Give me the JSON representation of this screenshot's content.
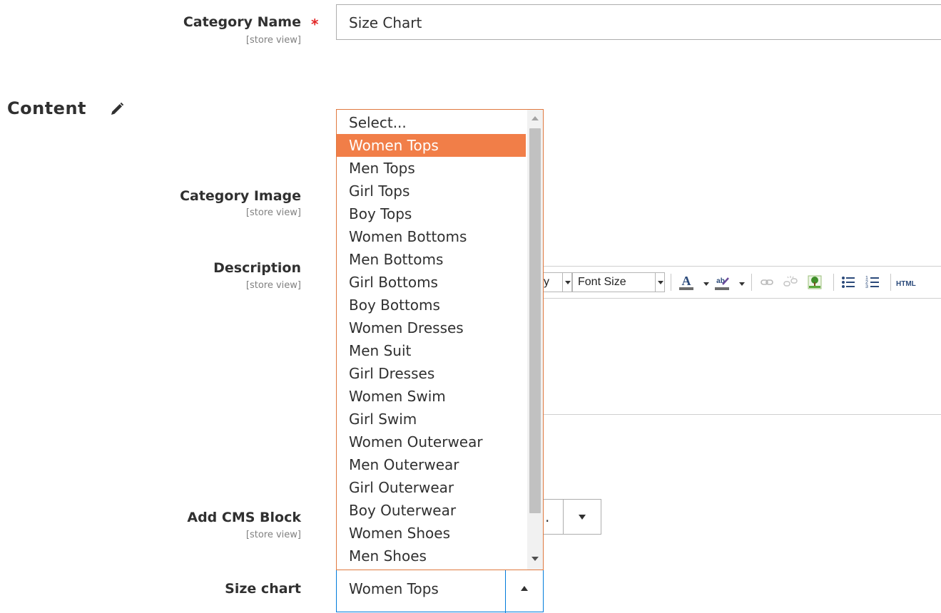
{
  "form": {
    "category_name": {
      "label": "Category Name",
      "required_mark": "*",
      "scope": "[store view]",
      "value": "Size Chart"
    },
    "content_section": {
      "title": "Content"
    },
    "category_image": {
      "label": "Category Image",
      "scope": "[store view]"
    },
    "description": {
      "label": "Description",
      "scope": "[store view]"
    },
    "cms_block": {
      "label": "Add CMS Block",
      "scope": "[store view]",
      "value_fragment": "."
    },
    "size_chart": {
      "label": "Size chart",
      "value": "Women Tops",
      "options": [
        "Select...",
        "Women Tops",
        "Men Tops",
        "Girl Tops",
        "Boy Tops",
        "Women Bottoms",
        "Men Bottoms",
        "Girl Bottoms",
        "Boy Bottoms",
        "Women Dresses",
        "Men Suit",
        "Girl Dresses",
        "Women Swim",
        "Girl Swim",
        "Women Outerwear",
        "Men Outerwear",
        "Girl Outerwear",
        "Boy Outerwear",
        "Women Shoes",
        "Men Shoes"
      ],
      "selected_index": 1
    }
  },
  "editor_toolbar": {
    "font_family_fragment": "y",
    "font_size": "Font Size",
    "html_button": "HTML",
    "icons": [
      "font-color-icon",
      "background-color-icon",
      "insert-link-icon",
      "unlink-icon",
      "insert-image-icon",
      "bullet-list-icon",
      "numbered-list-icon"
    ]
  },
  "colors": {
    "accent": "#f17e48",
    "focus_border": "#007bdb",
    "required": "#e22626"
  }
}
